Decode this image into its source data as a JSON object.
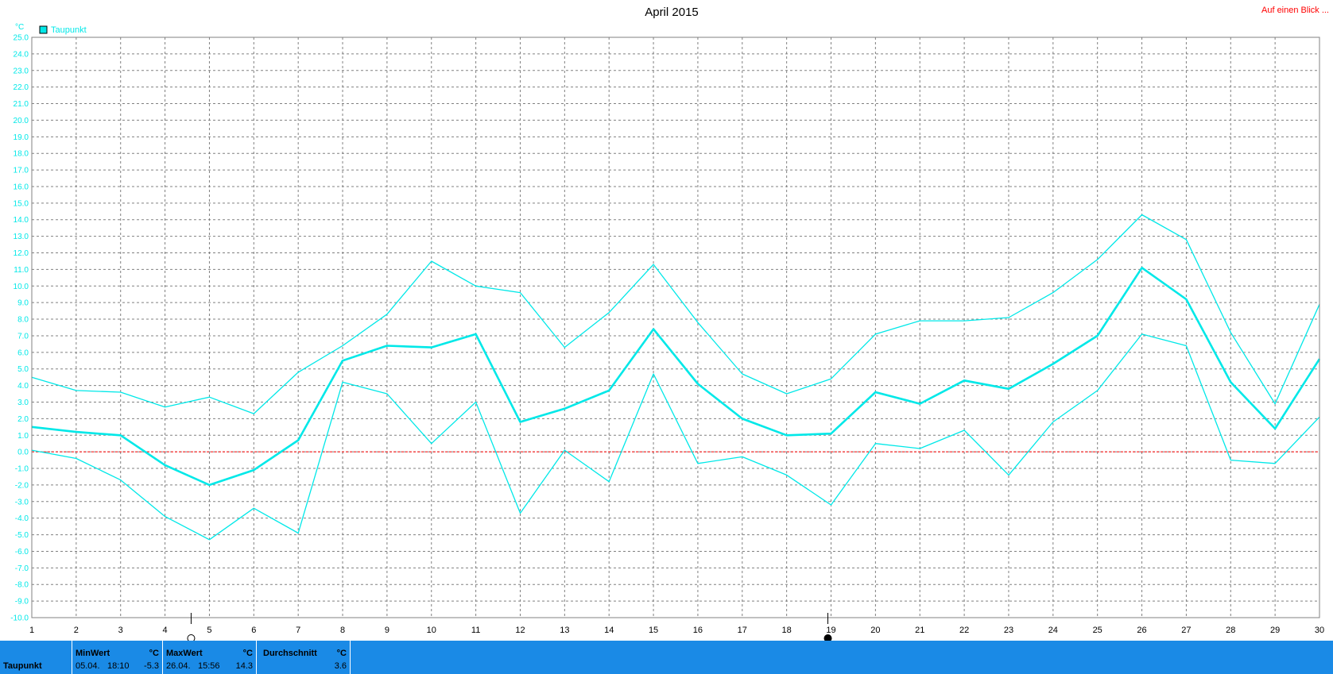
{
  "header": {
    "title": "April 2015",
    "link_label": "Auf einen Blick ..."
  },
  "colors": {
    "series": "#00e8e8",
    "zero_line": "#ff0000",
    "grid": "#808080",
    "stats_bar": "#1a8ae6"
  },
  "icons": {
    "full_moon_day": 5,
    "new_moon_day": 19
  },
  "chart_data": {
    "type": "line",
    "title": "April 2015",
    "ylabel": "°C",
    "xlabel": "",
    "ylim": [
      -10.0,
      25.0
    ],
    "ystep": 1.0,
    "grid": true,
    "legend_position": "top-left",
    "legend": [
      "Taupunkt"
    ],
    "x": [
      1,
      2,
      3,
      4,
      5,
      6,
      7,
      8,
      9,
      10,
      11,
      12,
      13,
      14,
      15,
      16,
      17,
      18,
      19,
      20,
      21,
      22,
      23,
      24,
      25,
      26,
      27,
      28,
      29,
      30
    ],
    "y_tick_labels": [
      "25.0",
      "24.0",
      "23.0",
      "22.0",
      "21.0",
      "20.0",
      "19.0",
      "18.0",
      "17.0",
      "16.0",
      "15.0",
      "14.0",
      "13.0",
      "12.0",
      "11.0",
      "10.0",
      "9.0",
      "8.0",
      "7.0",
      "6.0",
      "5.0",
      "4.0",
      "3.0",
      "2.0",
      "1.0",
      "0.0",
      "-1.0",
      "-2.0",
      "-3.0",
      "-4.0",
      "-5.0",
      "-6.0",
      "-7.0",
      "-8.0",
      "-9.0",
      "-10.0"
    ],
    "series": [
      {
        "name": "Taupunkt",
        "role": "max",
        "values": [
          4.5,
          3.7,
          3.6,
          2.7,
          3.3,
          2.3,
          4.8,
          6.4,
          8.3,
          11.5,
          10.0,
          9.6,
          6.3,
          8.4,
          11.3,
          7.8,
          4.7,
          3.5,
          4.4,
          7.1,
          7.9,
          7.9,
          8.1,
          9.6,
          11.6,
          14.3,
          12.8,
          7.2,
          2.9,
          8.9
        ]
      },
      {
        "name": "Taupunkt",
        "role": "avg",
        "values": [
          1.5,
          1.2,
          1.0,
          -0.8,
          -2.0,
          -1.1,
          0.7,
          5.5,
          6.4,
          6.3,
          7.1,
          1.8,
          2.6,
          3.7,
          7.4,
          4.1,
          2.0,
          1.0,
          1.1,
          3.6,
          2.9,
          4.3,
          3.8,
          5.3,
          7.0,
          11.1,
          9.2,
          4.2,
          1.4,
          5.6
        ]
      },
      {
        "name": "Taupunkt",
        "role": "min",
        "values": [
          0.1,
          -0.4,
          -1.7,
          -3.9,
          -5.3,
          -3.4,
          -4.9,
          4.2,
          3.5,
          0.5,
          3.0,
          -3.7,
          0.1,
          -1.8,
          4.7,
          -0.7,
          -0.3,
          -1.4,
          -3.2,
          0.5,
          0.2,
          1.3,
          -1.4,
          1.8,
          3.7,
          7.1,
          6.4,
          -0.5,
          -0.7,
          2.1
        ]
      }
    ]
  },
  "stats": {
    "series_label": "Taupunkt",
    "min": {
      "header": "MinWert",
      "unit": "°C",
      "date": "05.04.",
      "time": "18:10",
      "value": "-5.3"
    },
    "max": {
      "header": "MaxWert",
      "unit": "°C",
      "date": "26.04.",
      "time": "15:56",
      "value": "14.3"
    },
    "avg": {
      "header": "Durchschnitt",
      "unit": "°C",
      "value": "3.6"
    }
  }
}
